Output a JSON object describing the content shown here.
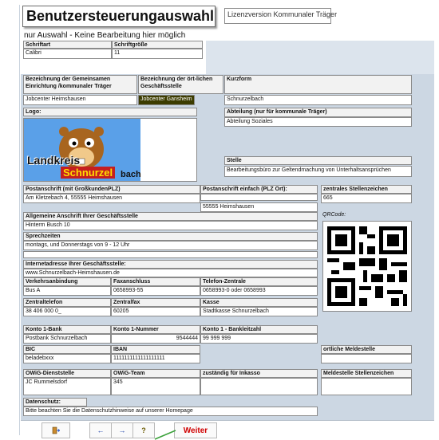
{
  "header": {
    "title": "Benutzersteuerungauswahl",
    "license": "Lizenzversion Kommunaler Träger",
    "subtitle": "nur Auswahl - Keine Bearbeitung hier möglich"
  },
  "font": {
    "label_family": "Schriftart",
    "family": "Calibri",
    "label_size": "Schriftgröße",
    "size": "11"
  },
  "org": {
    "label_name": "Bezeichnung der Gemeinsamen Einrichtung /kommunaler Träger",
    "name": "Jobcenter Heimshausen",
    "label_local": "Bezeichnung der ört-lichen Geschäftsstelle",
    "local": "Jobcenter Gansheim",
    "label_short": "Kurzform",
    "short": "Schnurzelbach",
    "label_dept": "Abteilung (nur für kommunale Träger)",
    "dept": "Abteilung Soziales",
    "label_logo": "Logo:",
    "label_stelle": "Stelle",
    "stelle": "Bearbeitungsbüro zur Geltendmachung von Unterhaltsansprüchen"
  },
  "logo": {
    "text1": "Landkreis",
    "text2": "Schnurzel",
    "text3": "bach"
  },
  "address": {
    "label_post": "Postanschrift (mit GroßkundenPLZ)",
    "post": "Am Kletzebach 4, 55555 Heimshausen",
    "label_post_simple": "Postanschrift einfach (PLZ Ort):",
    "post_simple": "55555 Heimshausen",
    "label_central": "zentrales Stellenzeichen",
    "central": "665",
    "label_general": "Allgemeine Anschrift Ihrer Geschäftsstelle",
    "general": "Hinterm Busch 10",
    "label_qr": "QRCode:",
    "label_hours": "Sprechzeiten",
    "hours": "montags, und Donnerstags von 9 - 12 Uhr",
    "label_web": "Internetadresse Ihrer Geschäftsstelle:",
    "web": "www.Schnurzelbach-Heimshausen.de"
  },
  "contact": {
    "label_transport": "Verkehrsanbindung",
    "transport": "Bus A",
    "label_fax": "Faxanschluss",
    "fax": "0658993-55",
    "label_tel": "Telefon-Zentrale",
    "tel": "0658993-0 oder 0658993",
    "label_zentel": "Zentraltelefon",
    "zentel": "38 406 000 0_",
    "label_zenfax": "Zentralfax",
    "zenfax": "60205",
    "label_kasse": "Kasse",
    "kasse": "Stadtkasse Schnurzelbach"
  },
  "bank": {
    "label_k1bank": "Konto 1-Bank",
    "k1bank": "Postbank Schnurzelbach",
    "label_k1nr": "Konto 1-Nummer",
    "k1nr": "9544444",
    "label_k1blz": "Konto 1 - Bankleitzahl",
    "k1blz": "99 999 999",
    "label_bic": "BIC",
    "bic": "beladebxxx",
    "label_iban": "IBAN",
    "iban": "1111111111111111111",
    "label_melde": "ortliche Meldestelle"
  },
  "owig": {
    "label_dienst": "OWiG-Dienststelle",
    "dienst": "JC Rummelsdorf",
    "label_team": "OWiG-Team",
    "team": "345",
    "label_inkasso": "zuständig für Inkasso",
    "label_meldezeichen": "Meldestelle Stellenzeichen"
  },
  "privacy": {
    "label": "Datenschutz:",
    "text": "Bitte beachten Sie die Datenschutzhinweise auf unserer Homepage"
  },
  "toolbar": {
    "weiter": "Weiter",
    "prev": "←",
    "next": "→",
    "help": "?"
  },
  "colors": {
    "panel": "#ccd7e3",
    "accent": "#d00000"
  }
}
